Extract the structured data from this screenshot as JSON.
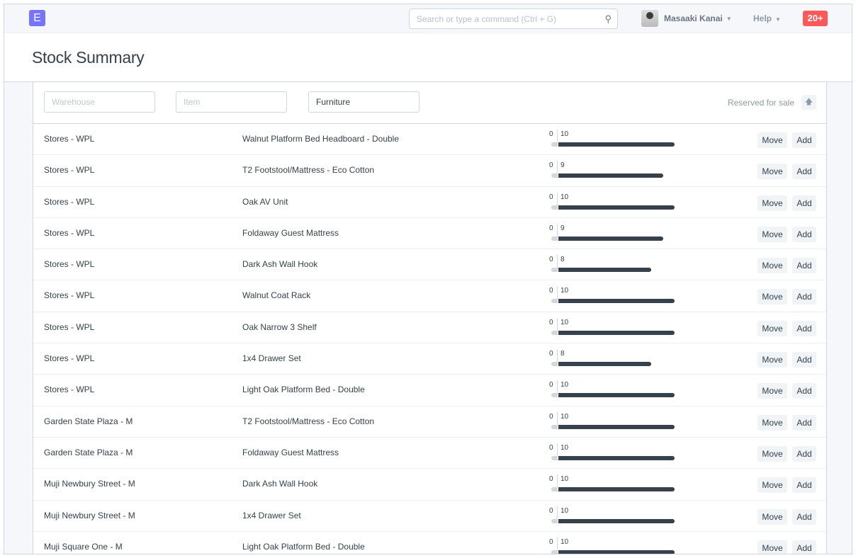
{
  "nav": {
    "logo": "E",
    "search_placeholder": "Search or type a command (Ctrl + G)",
    "user": "Masaaki Kanai",
    "help": "Help",
    "notifications": "20+"
  },
  "page": {
    "title": "Stock Summary"
  },
  "filters": {
    "warehouse_placeholder": "Warehouse",
    "item_placeholder": "Item",
    "item_group_value": "Furniture",
    "sort_label": "Reserved for sale",
    "sort_icon": "arrow-up-icon"
  },
  "colors": {
    "accent": "#7574ff",
    "badge": "#ff5858",
    "bar": "#36414c",
    "reserved": "#d1d8dd"
  },
  "actions": {
    "move": "Move",
    "add": "Add"
  },
  "rows": [
    {
      "warehouse": "Stores - WPL",
      "item": "Walnut Platform Bed Headboard - Double",
      "reserved": 0,
      "actual": 10
    },
    {
      "warehouse": "Stores - WPL",
      "item": "T2 Footstool/Mattress - Eco Cotton",
      "reserved": 0,
      "actual": 9
    },
    {
      "warehouse": "Stores - WPL",
      "item": "Oak AV Unit",
      "reserved": 0,
      "actual": 10
    },
    {
      "warehouse": "Stores - WPL",
      "item": "Foldaway Guest Mattress",
      "reserved": 0,
      "actual": 9
    },
    {
      "warehouse": "Stores - WPL",
      "item": "Dark Ash Wall Hook",
      "reserved": 0,
      "actual": 8
    },
    {
      "warehouse": "Stores - WPL",
      "item": "Walnut Coat Rack",
      "reserved": 0,
      "actual": 10
    },
    {
      "warehouse": "Stores - WPL",
      "item": "Oak Narrow 3 Shelf",
      "reserved": 0,
      "actual": 10
    },
    {
      "warehouse": "Stores - WPL",
      "item": "1x4 Drawer Set",
      "reserved": 0,
      "actual": 8
    },
    {
      "warehouse": "Stores - WPL",
      "item": "Light Oak Platform Bed - Double",
      "reserved": 0,
      "actual": 10
    },
    {
      "warehouse": "Garden State Plaza - M",
      "item": "T2 Footstool/Mattress - Eco Cotton",
      "reserved": 0,
      "actual": 10
    },
    {
      "warehouse": "Garden State Plaza - M",
      "item": "Foldaway Guest Mattress",
      "reserved": 0,
      "actual": 10
    },
    {
      "warehouse": "Muji Newbury Street - M",
      "item": "Dark Ash Wall Hook",
      "reserved": 0,
      "actual": 10
    },
    {
      "warehouse": "Muji Newbury Street - M",
      "item": "1x4 Drawer Set",
      "reserved": 0,
      "actual": 10
    },
    {
      "warehouse": "Muji Square One - M",
      "item": "Light Oak Platform Bed - Double",
      "reserved": 0,
      "actual": 10
    }
  ]
}
